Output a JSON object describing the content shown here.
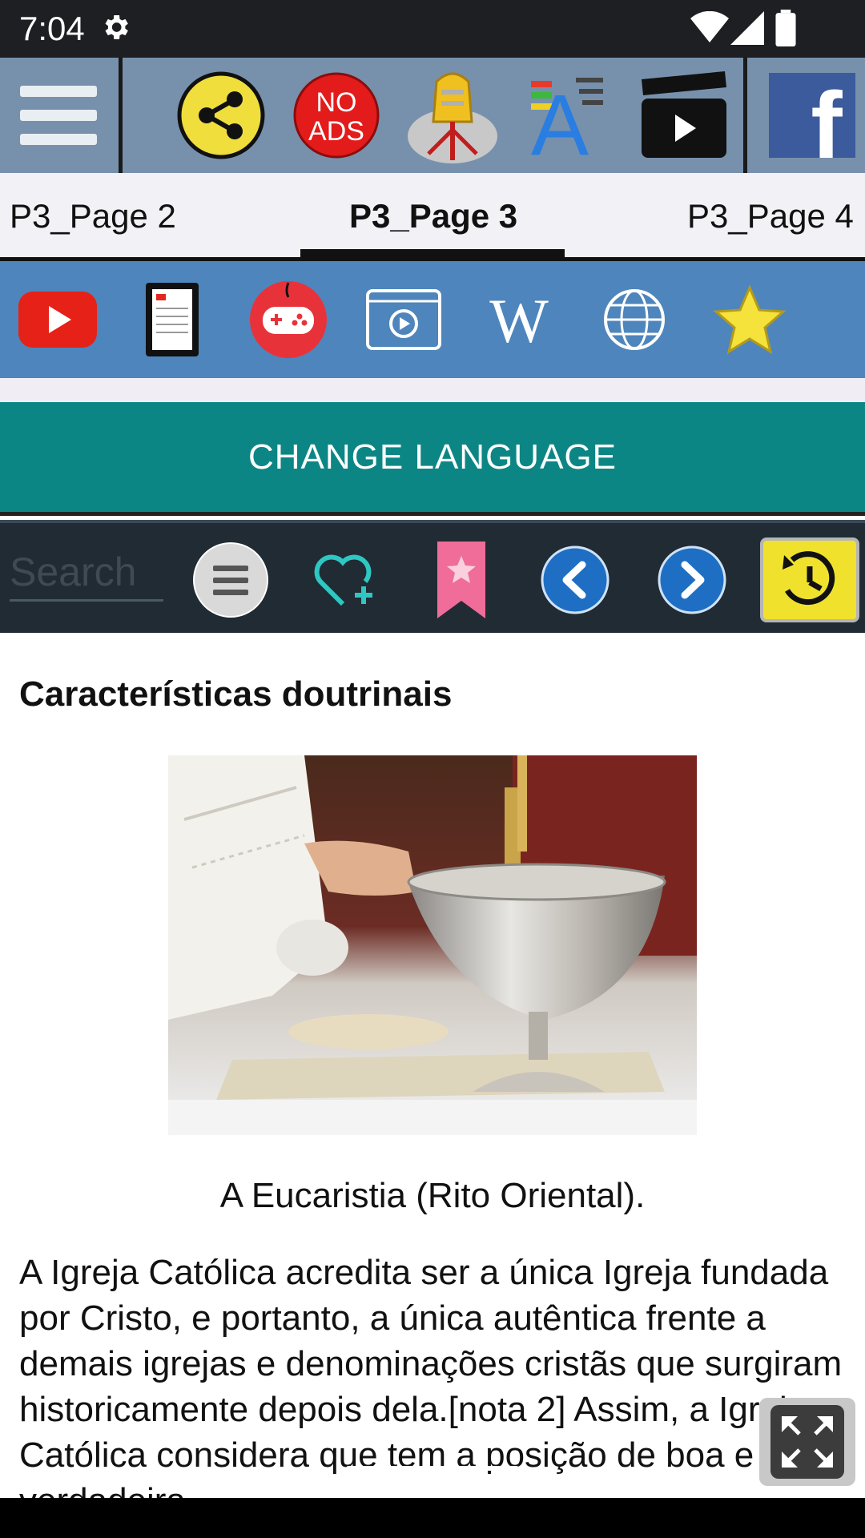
{
  "status": {
    "time": "7:04"
  },
  "topbar": {
    "items": [
      {
        "name": "menu-icon"
      },
      {
        "name": "share-icon"
      },
      {
        "name": "no-ads-icon",
        "label_line1": "NO",
        "label_line2": "ADS"
      },
      {
        "name": "vatican-emblem-icon"
      },
      {
        "name": "font-size-icon",
        "label": "A"
      },
      {
        "name": "video-clapper-icon"
      },
      {
        "name": "facebook-icon",
        "label": "f"
      }
    ]
  },
  "tabs": [
    {
      "label": "P3_Page 2"
    },
    {
      "label": "P3_Page 3"
    },
    {
      "label": "P3_Page 4"
    }
  ],
  "iconbar": {
    "items": [
      {
        "name": "youtube-icon"
      },
      {
        "name": "ebook-icon"
      },
      {
        "name": "gamepad-icon"
      },
      {
        "name": "video-player-icon"
      },
      {
        "name": "wikipedia-icon",
        "label": "W"
      },
      {
        "name": "globe-icon"
      },
      {
        "name": "star-icon"
      }
    ]
  },
  "language_button": {
    "label": "CHANGE LANGUAGE"
  },
  "toolbar": {
    "search_placeholder": "Search",
    "tools": [
      "list-icon",
      "favorite-add-icon",
      "bookmark-icon",
      "back-icon",
      "forward-icon",
      "history-icon"
    ]
  },
  "article": {
    "heading": "Características doutrinais",
    "caption": "A Eucaristia (Rito Oriental).",
    "body": "A Igreja Católica acredita ser a única Igreja fundada por Cristo, e portanto, a única autêntica frente a demais igrejas e denominações cristãs que surgiram historicamente depois dela.[nota 2] Assim, a Igreja Católica considera que tem a posição de boa e verdadeira..."
  },
  "colors": {
    "topbar": "#7791ad",
    "iconbar": "#4e85bc",
    "language_button": "#0c8685",
    "toolbar": "#212b33"
  }
}
